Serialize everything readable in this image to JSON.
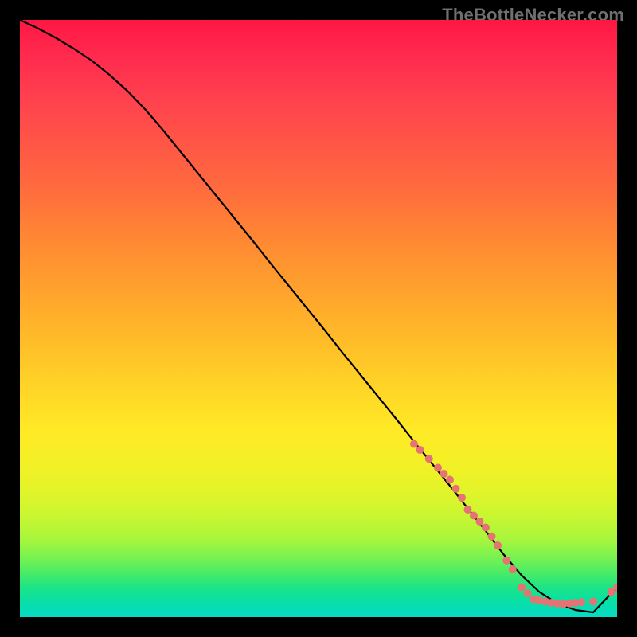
{
  "watermark": "TheBottleNecker.com",
  "chart_data": {
    "type": "line",
    "title": "",
    "xlabel": "",
    "ylabel": "",
    "xlim": [
      0,
      100
    ],
    "ylim": [
      0,
      100
    ],
    "series": [
      {
        "name": "curve",
        "x": [
          0,
          3,
          6,
          9,
          12,
          15,
          18,
          21,
          24,
          27,
          30,
          33,
          36,
          39,
          42,
          45,
          48,
          51,
          54,
          57,
          60,
          63,
          66,
          69,
          72,
          75,
          78,
          81,
          84,
          87,
          90,
          93,
          96,
          100
        ],
        "y": [
          100.0,
          98.6,
          97.0,
          95.2,
          93.2,
          90.8,
          88.1,
          85.0,
          81.5,
          77.8,
          74.1,
          70.4,
          66.7,
          63.0,
          59.2,
          55.5,
          51.8,
          48.1,
          44.3,
          40.6,
          36.9,
          33.2,
          29.4,
          25.7,
          22.0,
          18.2,
          14.4,
          10.5,
          7.0,
          4.2,
          2.3,
          1.2,
          0.8,
          5.0
        ]
      }
    ],
    "markers": [
      {
        "x": 66.0,
        "y": 29.0,
        "r": 5
      },
      {
        "x": 67.0,
        "y": 28.0,
        "r": 5
      },
      {
        "x": 68.5,
        "y": 26.5,
        "r": 5
      },
      {
        "x": 70.0,
        "y": 25.0,
        "r": 5
      },
      {
        "x": 71.0,
        "y": 24.0,
        "r": 5
      },
      {
        "x": 72.0,
        "y": 23.0,
        "r": 5
      },
      {
        "x": 73.0,
        "y": 21.5,
        "r": 5
      },
      {
        "x": 74.0,
        "y": 20.0,
        "r": 5
      },
      {
        "x": 75.0,
        "y": 18.0,
        "r": 5
      },
      {
        "x": 76.0,
        "y": 17.0,
        "r": 5
      },
      {
        "x": 77.0,
        "y": 16.0,
        "r": 5
      },
      {
        "x": 78.0,
        "y": 15.0,
        "r": 5
      },
      {
        "x": 79.0,
        "y": 13.5,
        "r": 5
      },
      {
        "x": 80.0,
        "y": 12.0,
        "r": 5
      },
      {
        "x": 81.5,
        "y": 9.5,
        "r": 5
      },
      {
        "x": 82.5,
        "y": 8.0,
        "r": 5
      },
      {
        "x": 84.0,
        "y": 5.0,
        "r": 5
      },
      {
        "x": 85.0,
        "y": 4.0,
        "r": 5
      },
      {
        "x": 86.0,
        "y": 3.0,
        "r": 5
      },
      {
        "x": 87.0,
        "y": 2.8,
        "r": 5
      },
      {
        "x": 88.0,
        "y": 2.6,
        "r": 5
      },
      {
        "x": 89.0,
        "y": 2.4,
        "r": 5
      },
      {
        "x": 90.0,
        "y": 2.3,
        "r": 5
      },
      {
        "x": 91.0,
        "y": 2.2,
        "r": 5
      },
      {
        "x": 92.0,
        "y": 2.3,
        "r": 5
      },
      {
        "x": 93.0,
        "y": 2.4,
        "r": 5
      },
      {
        "x": 94.0,
        "y": 2.5,
        "r": 5
      },
      {
        "x": 96.0,
        "y": 2.6,
        "r": 5
      },
      {
        "x": 99.0,
        "y": 4.2,
        "r": 5
      },
      {
        "x": 100.0,
        "y": 5.0,
        "r": 5
      }
    ],
    "marker_color": "#e57373",
    "curve_color": "#000000"
  }
}
